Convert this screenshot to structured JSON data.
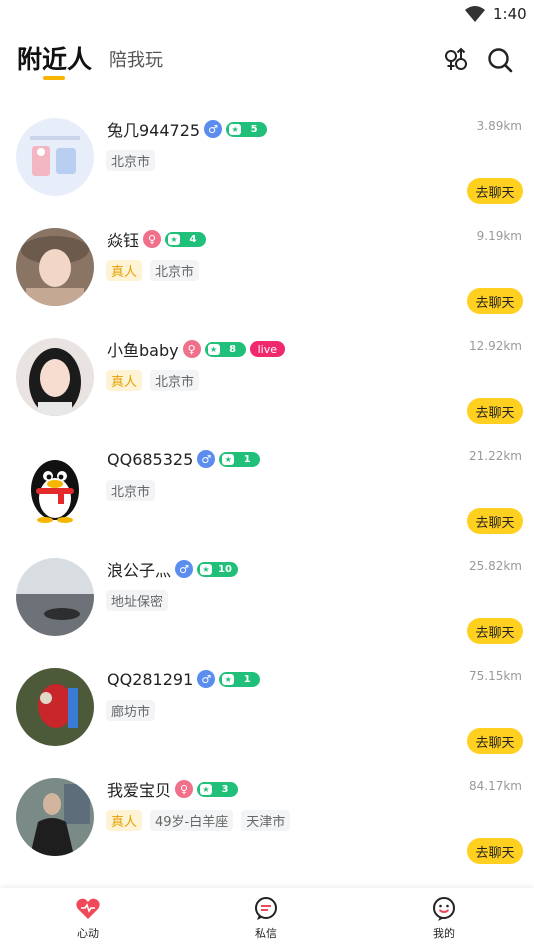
{
  "status": {
    "time": "1:40"
  },
  "header": {
    "tab_active": "附近人",
    "tab_inactive": "陪我玩"
  },
  "users": [
    {
      "name": "兔几944725",
      "gender": "male",
      "gender_symbol": "♂",
      "level": "5",
      "distance": "3.89km",
      "tags": [
        "北京市"
      ],
      "real": false,
      "live": false,
      "chat": "去聊天"
    },
    {
      "name": "焱钰",
      "gender": "female",
      "gender_symbol": "♀",
      "level": "4",
      "distance": "9.19km",
      "tags": [
        "北京市"
      ],
      "real": true,
      "live": false,
      "chat": "去聊天"
    },
    {
      "name": "小鱼baby",
      "gender": "female",
      "gender_symbol": "♀",
      "level": "8",
      "distance": "12.92km",
      "tags": [
        "北京市"
      ],
      "real": true,
      "live": true,
      "live_label": "live",
      "chat": "去聊天"
    },
    {
      "name": "QQ685325",
      "gender": "male",
      "gender_symbol": "♂",
      "level": "1",
      "distance": "21.22km",
      "tags": [
        "北京市"
      ],
      "real": false,
      "live": false,
      "chat": "去聊天"
    },
    {
      "name": "浪公子灬",
      "gender": "male",
      "gender_symbol": "♂",
      "level": "10",
      "distance": "25.82km",
      "tags": [
        "地址保密"
      ],
      "real": false,
      "live": false,
      "chat": "去聊天"
    },
    {
      "name": "QQ281291",
      "gender": "male",
      "gender_symbol": "♂",
      "level": "1",
      "distance": "75.15km",
      "tags": [
        "廊坊市"
      ],
      "real": false,
      "live": false,
      "chat": "去聊天"
    },
    {
      "name": "我爱宝贝",
      "gender": "female",
      "gender_symbol": "♀",
      "level": "3",
      "distance": "84.17km",
      "tags": [
        "49岁-白羊座",
        "天津市"
      ],
      "real": true,
      "live": false,
      "chat": "去聊天"
    }
  ],
  "real_label": "真人",
  "bottom_nav": [
    {
      "label": "心动",
      "icon": "heart-icon",
      "color": "#f04a5a"
    },
    {
      "label": "私信",
      "icon": "message-icon",
      "color": "#222222"
    },
    {
      "label": "我的",
      "icon": "profile-icon",
      "color": "#222222"
    }
  ],
  "colors": {
    "accent": "#ffd01f",
    "tab_underline": "#f7b500",
    "level": "#21c07a",
    "live": "#f0286d"
  }
}
